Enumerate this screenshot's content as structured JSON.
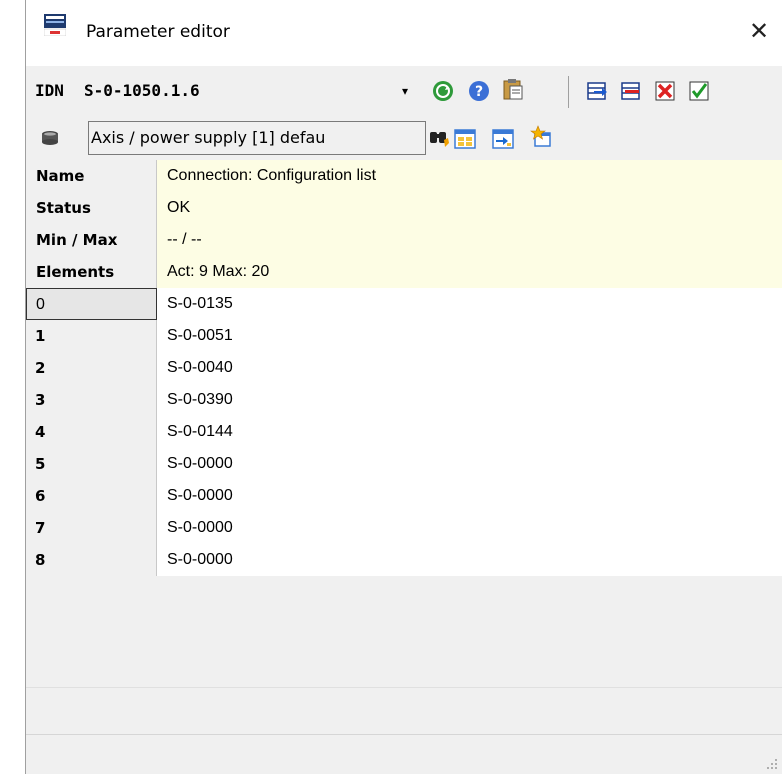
{
  "window": {
    "title": "Parameter editor",
    "close_symbol": "✕"
  },
  "toolbar": {
    "idn_label": "IDN",
    "idn_value": "S-0-1050.1.6",
    "dropdown_symbol": "▾",
    "icons": [
      "refresh-icon",
      "help-icon",
      "clipboard-icon",
      "insert-row-icon",
      "remove-row-icon",
      "delete-icon",
      "apply-icon"
    ]
  },
  "source": {
    "value": "Axis / power supply [1] defau",
    "icons": [
      "database-icon",
      "find-icon",
      "table-view-icon",
      "table-export-icon",
      "star-icon"
    ]
  },
  "info": {
    "name_label": "Name",
    "name_value": "Connection: Configuration list",
    "status_label": "Status",
    "status_value": "OK",
    "minmax_label": "Min / Max",
    "minmax_value": "-- / --",
    "elements_label": "Elements",
    "elements_value": "Act: 9  Max: 20"
  },
  "elements": [
    {
      "index": "0",
      "value": "S-0-0135"
    },
    {
      "index": "1",
      "value": "S-0-0051"
    },
    {
      "index": "2",
      "value": "S-0-0040"
    },
    {
      "index": "3",
      "value": "S-0-0390"
    },
    {
      "index": "4",
      "value": "S-0-0144"
    },
    {
      "index": "5",
      "value": "S-0-0000"
    },
    {
      "index": "6",
      "value": "S-0-0000"
    },
    {
      "index": "7",
      "value": "S-0-0000"
    },
    {
      "index": "8",
      "value": "S-0-0000"
    }
  ],
  "colors": {
    "info_background": "#fdfde4",
    "window_background": "#f0f0f0"
  }
}
